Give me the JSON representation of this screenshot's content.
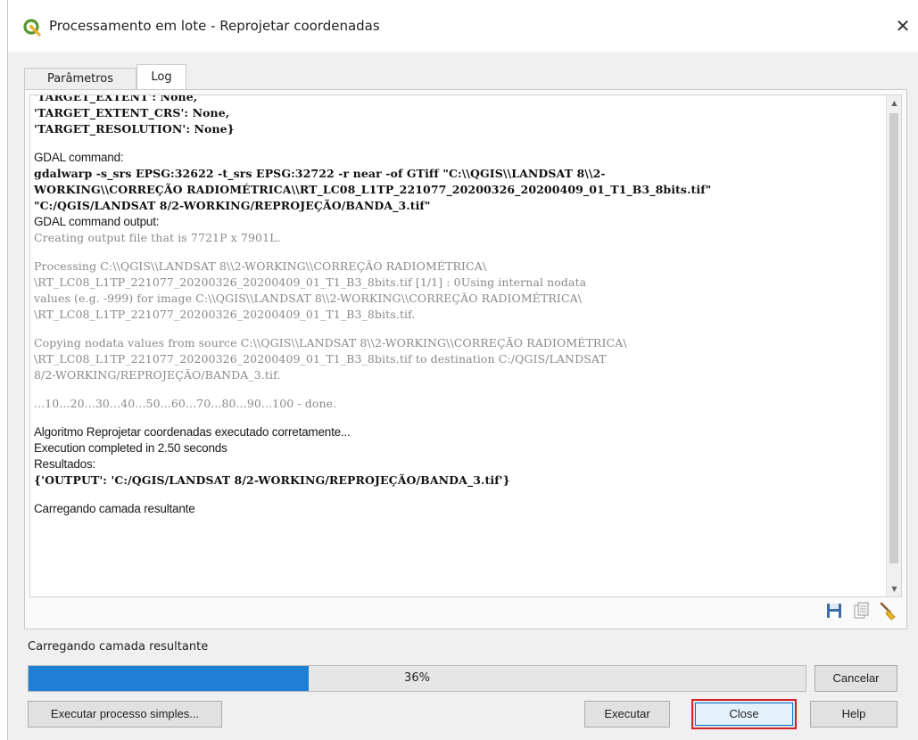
{
  "window": {
    "title": "Processamento em lote - Reprojetar coordenadas",
    "close_glyph": "✕"
  },
  "tabs": [
    {
      "label": "Parâmetros"
    },
    {
      "label": "Log"
    }
  ],
  "log": {
    "lines": [
      "'TARGET_EXTENT': None,",
      "'TARGET_EXTENT_CRS': None,",
      "'TARGET_RESOLUTION': None}",
      "",
      "GDAL command:",
      "gdalwarp -s_srs EPSG:32622 -t_srs EPSG:32722 -r near -of GTiff \"C:\\\\QGIS\\\\LANDSAT 8\\\\2-",
      "WORKING\\\\CORREÇÃO RADIOMÉTRICA\\\\RT_LC08_L1TP_221077_20200326_20200409_01_T1_B3_8bits.tif\"",
      "\"C:/QGIS/LANDSAT 8/2-WORKING/REPROJEÇÃO/BANDA_3.tif\"",
      "GDAL command output:",
      "Creating output file that is 7721P x 7901L.",
      "",
      "Processing C:\\\\QGIS\\\\LANDSAT 8\\\\2-WORKING\\\\CORREÇÃO RADIOMÉTRICA\\",
      "\\RT_LC08_L1TP_221077_20200326_20200409_01_T1_B3_8bits.tif [1/1] : 0Using internal nodata",
      "values (e.g. -999) for image C:\\\\QGIS\\\\LANDSAT 8\\\\2-WORKING\\\\CORREÇÃO RADIOMÉTRICA\\",
      "\\RT_LC08_L1TP_221077_20200326_20200409_01_T1_B3_8bits.tif.",
      "",
      "Copying nodata values from source C:\\\\QGIS\\\\LANDSAT 8\\\\2-WORKING\\\\CORREÇÃO RADIOMÉTRICA\\",
      "\\RT_LC08_L1TP_221077_20200326_20200409_01_T1_B3_8bits.tif to destination C:/QGIS/LANDSAT",
      "8/2-WORKING/REPROJEÇÃO/BANDA_3.tif.",
      "",
      "...10...20...30...40...50...60...70...80...90...100 - done.",
      "",
      "Algoritmo Reprojetar coordenadas executado corretamente...",
      "Execution completed in 2.50 seconds",
      "Resultados:",
      "{'OUTPUT': 'C:/QGIS/LANDSAT 8/2-WORKING/REPROJEÇÃO/BANDA_3.tif'}",
      "",
      "Carregando camada resultante"
    ]
  },
  "log_tools": {
    "save_icon": "save-icon",
    "copy_icon": "copy-icon",
    "clear_icon": "clear-icon"
  },
  "progress": {
    "label": "Carregando camada resultante",
    "value": 0.36,
    "text": "36%",
    "fill_color": "#1e7fd4"
  },
  "buttons": {
    "cancel": "Cancelar",
    "run_single": "Executar processo simples...",
    "run": "Executar",
    "close": "Close",
    "help": "Help"
  }
}
